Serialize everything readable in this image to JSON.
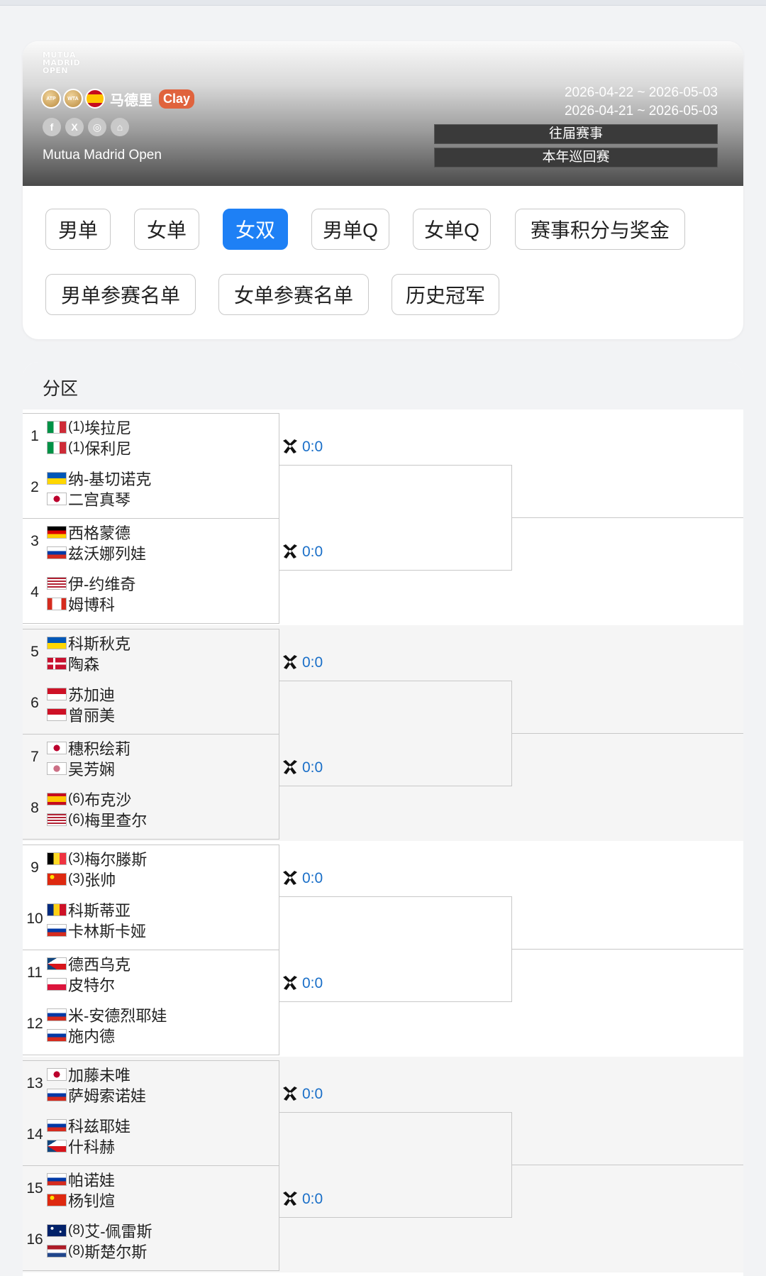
{
  "header": {
    "logo_lines": [
      "MUTUA",
      "MADRID",
      "OPEN"
    ],
    "badges": [
      "ATP",
      "WTA"
    ],
    "city": "马德里",
    "surface": "Clay",
    "tournament_name": "Mutua Madrid Open",
    "dates": [
      "2026-04-22 ~ 2026-05-03",
      "2026-04-21 ~ 2026-05-03"
    ],
    "buttons": [
      "往届赛事",
      "本年巡回赛"
    ],
    "social_icons": [
      "facebook-icon",
      "x-icon",
      "instagram-icon",
      "home-icon"
    ]
  },
  "tabs": [
    {
      "label": "男单",
      "active": false
    },
    {
      "label": "女单",
      "active": false
    },
    {
      "label": "女双",
      "active": true
    },
    {
      "label": "男单Q",
      "active": false
    },
    {
      "label": "女单Q",
      "active": false
    },
    {
      "label": "赛事积分与奖金",
      "active": false
    },
    {
      "label": "男单参赛名单",
      "active": false
    },
    {
      "label": "女单参赛名单",
      "active": false
    },
    {
      "label": "历史冠军",
      "active": false
    }
  ],
  "bracket": {
    "title": "分区",
    "matches": [
      {
        "score": "0:0",
        "teams": [
          {
            "num": "1",
            "players": [
              {
                "flag": "it",
                "seed": "(1)",
                "name": "埃拉尼"
              },
              {
                "flag": "it",
                "seed": "(1)",
                "name": "保利尼"
              }
            ]
          },
          {
            "num": "2",
            "players": [
              {
                "flag": "ua",
                "seed": "",
                "name": "纳-基切诺克"
              },
              {
                "flag": "jp",
                "seed": "",
                "name": "二宫真琴"
              }
            ]
          }
        ]
      },
      {
        "score": "0:0",
        "teams": [
          {
            "num": "3",
            "players": [
              {
                "flag": "de",
                "seed": "",
                "name": "西格蒙德"
              },
              {
                "flag": "ru",
                "seed": "",
                "name": "兹沃娜列娃"
              }
            ]
          },
          {
            "num": "4",
            "players": [
              {
                "flag": "us",
                "seed": "",
                "name": "伊-约维奇"
              },
              {
                "flag": "ca",
                "seed": "",
                "name": "姆博科"
              }
            ]
          }
        ]
      },
      {
        "score": "0:0",
        "teams": [
          {
            "num": "5",
            "players": [
              {
                "flag": "ua",
                "seed": "",
                "name": "科斯秋克"
              },
              {
                "flag": "dk",
                "seed": "",
                "name": "陶森"
              }
            ]
          },
          {
            "num": "6",
            "players": [
              {
                "flag": "id",
                "seed": "",
                "name": "苏加迪"
              },
              {
                "flag": "id",
                "seed": "",
                "name": "曾丽美"
              }
            ]
          }
        ]
      },
      {
        "score": "0:0",
        "teams": [
          {
            "num": "7",
            "players": [
              {
                "flag": "jp",
                "seed": "",
                "name": "穗积绘莉"
              },
              {
                "flag": "tpe",
                "seed": "",
                "name": "吴芳娴"
              }
            ]
          },
          {
            "num": "8",
            "players": [
              {
                "flag": "es",
                "seed": "(6)",
                "name": "布克沙"
              },
              {
                "flag": "us",
                "seed": "(6)",
                "name": "梅里查尔"
              }
            ]
          }
        ]
      },
      {
        "score": "0:0",
        "teams": [
          {
            "num": "9",
            "players": [
              {
                "flag": "be",
                "seed": "(3)",
                "name": "梅尔滕斯"
              },
              {
                "flag": "cn",
                "seed": "(3)",
                "name": "张帅"
              }
            ]
          },
          {
            "num": "10",
            "players": [
              {
                "flag": "ro",
                "seed": "",
                "name": "科斯蒂亚"
              },
              {
                "flag": "ru",
                "seed": "",
                "name": "卡林斯卡娅"
              }
            ]
          }
        ]
      },
      {
        "score": "0:0",
        "teams": [
          {
            "num": "11",
            "players": [
              {
                "flag": "cz",
                "seed": "",
                "name": "德西乌克"
              },
              {
                "flag": "pl",
                "seed": "",
                "name": "皮特尔"
              }
            ]
          },
          {
            "num": "12",
            "players": [
              {
                "flag": "ru",
                "seed": "",
                "name": "米-安德烈耶娃"
              },
              {
                "flag": "ru",
                "seed": "",
                "name": "施内德"
              }
            ]
          }
        ]
      },
      {
        "score": "0:0",
        "teams": [
          {
            "num": "13",
            "players": [
              {
                "flag": "jp",
                "seed": "",
                "name": "加藤未唯"
              },
              {
                "flag": "ru",
                "seed": "",
                "name": "萨姆索诺娃"
              }
            ]
          },
          {
            "num": "14",
            "players": [
              {
                "flag": "ru",
                "seed": "",
                "name": "科兹耶娃"
              },
              {
                "flag": "cz",
                "seed": "",
                "name": "什科赫"
              }
            ]
          }
        ]
      },
      {
        "score": "0:0",
        "teams": [
          {
            "num": "15",
            "players": [
              {
                "flag": "ru",
                "seed": "",
                "name": "帕诺娃"
              },
              {
                "flag": "cn",
                "seed": "",
                "name": "杨钊煊"
              }
            ]
          },
          {
            "num": "16",
            "players": [
              {
                "flag": "au",
                "seed": "(8)",
                "name": "艾-佩雷斯"
              },
              {
                "flag": "nl",
                "seed": "(8)",
                "name": "斯楚尔斯"
              }
            ]
          }
        ]
      }
    ]
  }
}
